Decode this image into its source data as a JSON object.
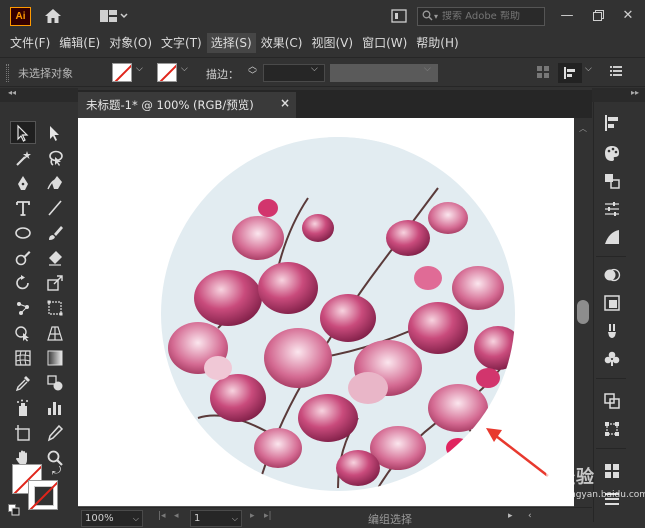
{
  "app": {
    "logo": "Ai",
    "search_placeholder": "搜索 Adobe 帮助",
    "accent": "#ff9a00"
  },
  "menu": [
    {
      "label": "文件(F)"
    },
    {
      "label": "编辑(E)"
    },
    {
      "label": "对象(O)"
    },
    {
      "label": "文字(T)"
    },
    {
      "label": "选择(S)"
    },
    {
      "label": "效果(C)"
    },
    {
      "label": "视图(V)"
    },
    {
      "label": "窗口(W)"
    },
    {
      "label": "帮助(H)"
    }
  ],
  "control_bar": {
    "no_selection": "未选择对象",
    "stroke_label": "描边："
  },
  "document": {
    "tab_title": "未标题-1* @ 100% (RGB/预览)",
    "close_symbol": "×"
  },
  "status_bar": {
    "zoom": "100%",
    "page": "1",
    "status": "编组选择"
  },
  "canvas": {
    "image_subject": "magnolia-blossoms-in-circle-mask",
    "arrow_color": "#e8392e",
    "sky_color": "#dfeaf0",
    "flower_color": "#b8285a"
  },
  "watermark": {
    "text": "Bai  经验",
    "sub": "jingyan.baidu.com"
  },
  "icons": {
    "home": "home-icon",
    "workspace": "workspace-switcher-icon",
    "arrange": "arrange-documents-icon",
    "search": "search-icon"
  }
}
